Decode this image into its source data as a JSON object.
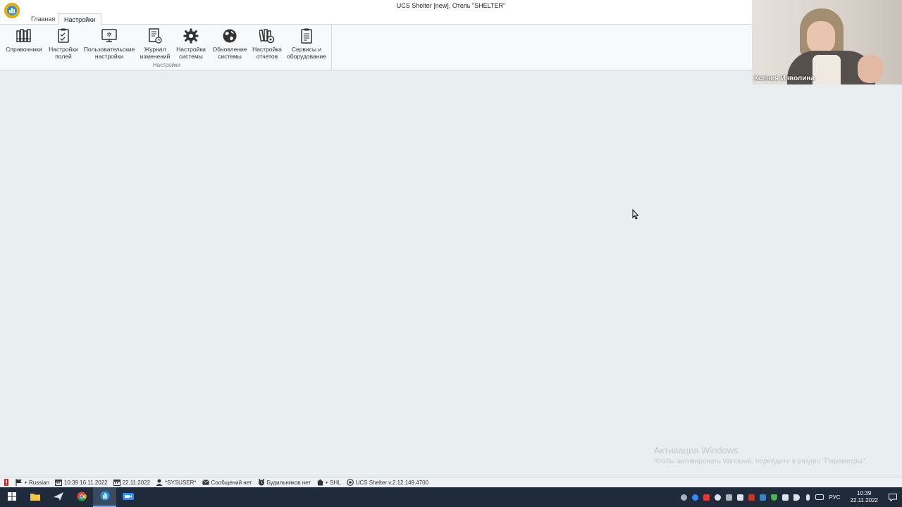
{
  "window": {
    "title": "UCS Shelter [new], Отель \"SHELTER\""
  },
  "tabs": [
    {
      "label": "Главная",
      "active": false
    },
    {
      "label": "Настройки",
      "active": true
    }
  ],
  "ribbon": {
    "group_label": "Настройки",
    "buttons": [
      {
        "label": "Справочники",
        "icon": "books-icon"
      },
      {
        "label": "Настройки\nполей",
        "icon": "checklist-icon"
      },
      {
        "label": "Пользовательские\nнастройки",
        "icon": "monitor-settings-icon"
      },
      {
        "label": "Журнал\nизменений",
        "icon": "log-icon"
      },
      {
        "label": "Настройки\nсистемы",
        "icon": "gear-icon"
      },
      {
        "label": "Обновление\nсистемы",
        "icon": "globe-icon"
      },
      {
        "label": "Настройка\nотчетов",
        "icon": "report-settings-icon"
      },
      {
        "label": "Сервисы и\nоборудование",
        "icon": "clipboard-icon"
      }
    ]
  },
  "watermark": {
    "line1": "Активация Windows",
    "line2": "Чтобы активировать Windows, перейдите в раздел \"Параметры\"."
  },
  "video": {
    "participant_name": "Ксения Изволина"
  },
  "statusbar": {
    "language": "Russian",
    "time_date": "10:39  16.11.2022",
    "business_date": "22.11.2022",
    "user": "*SYSUSER*",
    "messages": "Сообщений нет",
    "alarms": "Будильников нет",
    "hotel": "SHL",
    "version": "UCS Shelter v.2.12.149.4700"
  },
  "taskbar": {
    "language": "РУС",
    "time": "10:39",
    "date": "22.11.2022"
  },
  "colors": {
    "accent": "#2f8fd8",
    "logo": "#f2b705",
    "taskbar": "#1f2b3b",
    "workspace": "#e9eef1"
  }
}
